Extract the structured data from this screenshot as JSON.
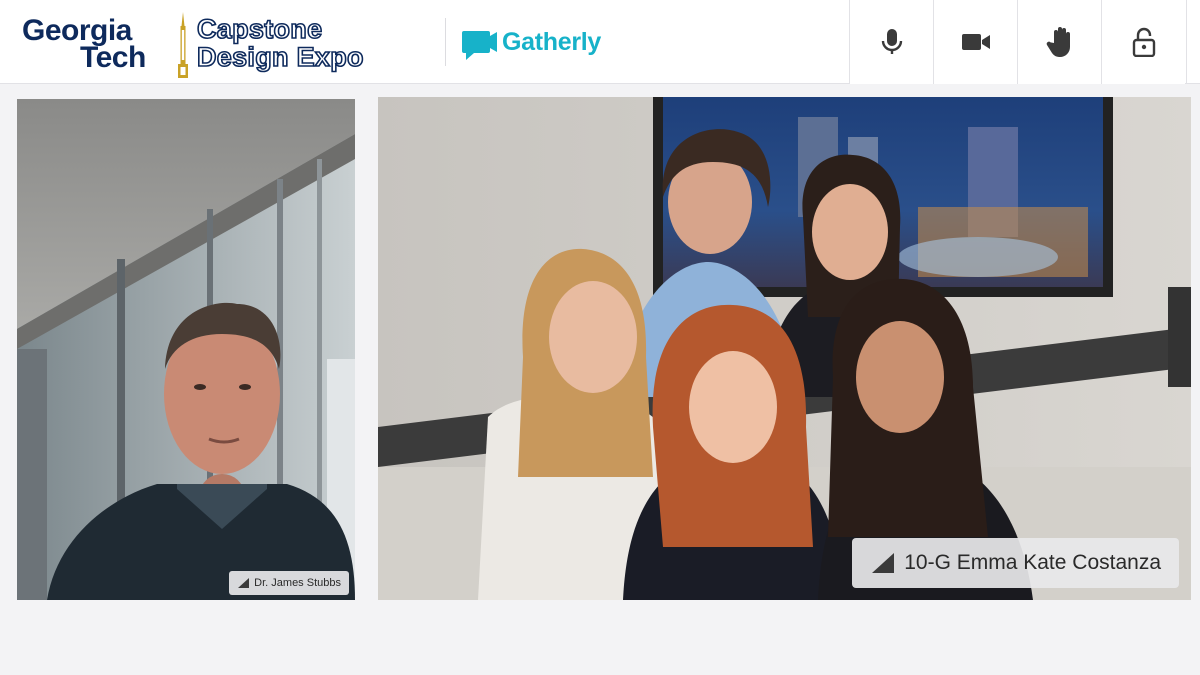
{
  "header": {
    "logo": {
      "line1": "Georgia",
      "line2": "Tech",
      "event_line1": "Capstone",
      "event_line2": "Design Expo"
    },
    "brand": {
      "name": "Gatherly",
      "color": "#17b2c9"
    },
    "controls": [
      {
        "id": "mic",
        "icon": "microphone-icon"
      },
      {
        "id": "camera",
        "icon": "video-camera-icon"
      },
      {
        "id": "raise-hand",
        "icon": "hand-icon"
      },
      {
        "id": "lock",
        "icon": "unlock-icon"
      }
    ]
  },
  "participants": [
    {
      "name": "Dr. James Stubbs",
      "icon": "signal-icon"
    },
    {
      "name": "10-G Emma Kate Costanza",
      "icon": "signal-icon"
    }
  ],
  "colors": {
    "navy": "#0e2a5c",
    "gold": "#b3a369",
    "background": "#f3f3f5"
  }
}
